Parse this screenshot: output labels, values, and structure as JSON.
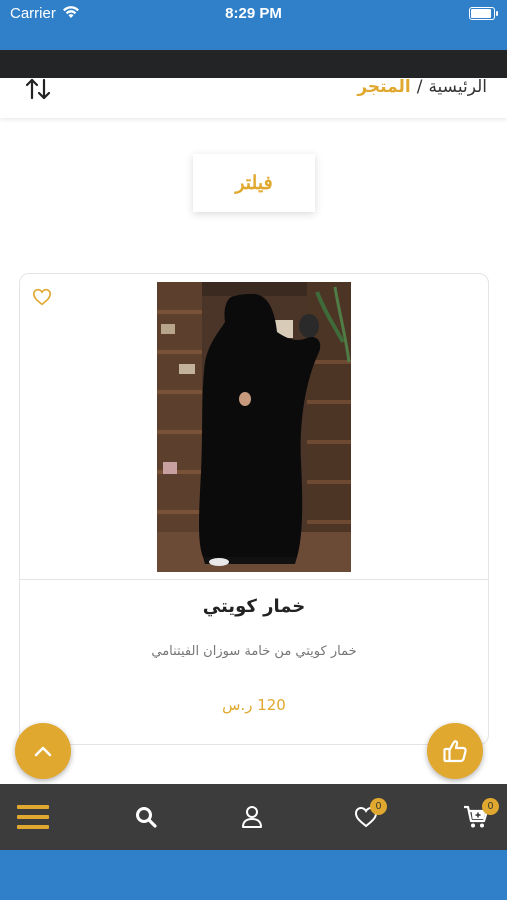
{
  "status_bar": {
    "carrier": "Carrier",
    "time": "8:29 PM"
  },
  "breadcrumb": {
    "home": "الرئيسية",
    "separator": "/",
    "current": "المتجر"
  },
  "filter": {
    "label": "فيلتر"
  },
  "product": {
    "name": "خمار كويتي",
    "description": "خمار كويتي من خامة سوزان الفيتنامي",
    "price": "120 ر.س"
  },
  "bottom_nav": {
    "items": [
      {
        "icon": "menu-icon"
      },
      {
        "icon": "search-icon"
      },
      {
        "icon": "user-icon"
      },
      {
        "icon": "heart-icon",
        "badge": "0"
      },
      {
        "icon": "cart-icon",
        "badge": "0"
      }
    ]
  },
  "colors": {
    "accent": "#e0a82e",
    "status_blue": "#2f80c9",
    "nav_dark": "#3c3c3c"
  }
}
